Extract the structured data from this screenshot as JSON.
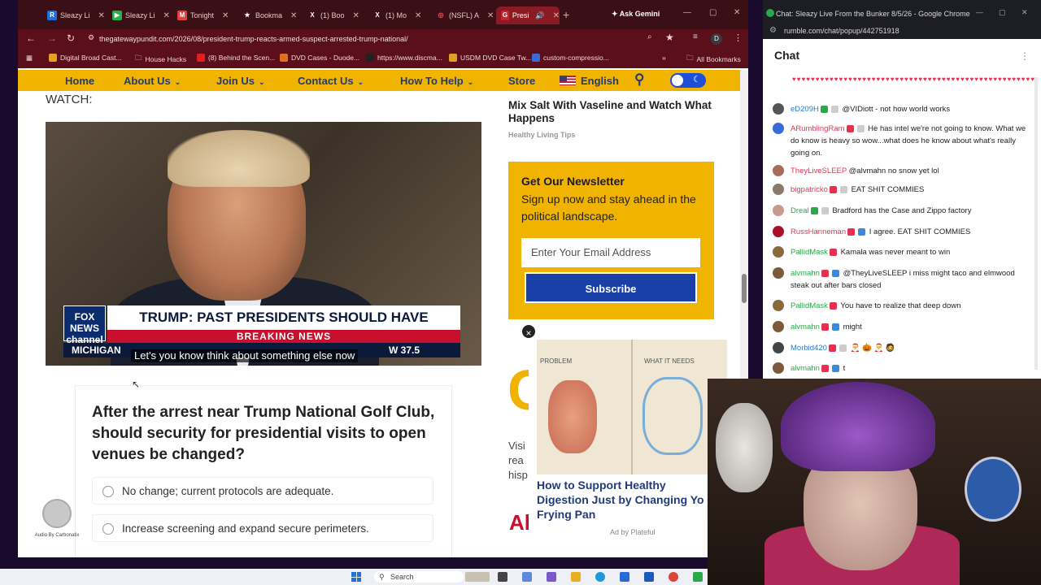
{
  "browser": {
    "tabs": [
      {
        "label": "Sleazy Li",
        "fav": "R",
        "color": "#1e6fe0"
      },
      {
        "label": "Sleazy Li",
        "fav": "▶",
        "color": "#24b14a"
      },
      {
        "label": "Tonight",
        "fav": "M",
        "color": "#e04040"
      },
      {
        "label": "Bookma",
        "fav": "★",
        "color": "#7a2a30"
      },
      {
        "label": "(1) Boo",
        "fav": "X",
        "color": "#222222"
      },
      {
        "label": "(1) Mo",
        "fav": "X",
        "color": "#222222"
      },
      {
        "label": "(NSFL) A",
        "fav": "◎",
        "color": "#d83030"
      },
      {
        "label": "Presi",
        "fav": "G",
        "color": "#c82030"
      }
    ],
    "ask_gemini": "Ask Gemini",
    "url": "thegatewaypundit.com/2026/08/president-trump-reacts-armed-suspect-arrested-trump-national/",
    "profile_initial": "D",
    "bookmarks": [
      "Digital Broad Cast...",
      "House Hacks",
      "(8) Behind the Scen...",
      "DVD Cases - Duode...",
      "https://www.discma...",
      "USDM DVD Case Tw...",
      "custom-compressio..."
    ],
    "all_bookmarks": "All Bookmarks"
  },
  "nav": {
    "items": [
      "Home",
      "About Us",
      "Join Us",
      "Contact Us",
      "How To Help",
      "Store"
    ],
    "language": "English"
  },
  "article": {
    "watch_label": "WATCH:",
    "video": {
      "network": "FOX NEWS channel",
      "headline": "TRUMP: PAST PRESIDENTS SHOULD HAVE CONFRONTED IRAN",
      "breaking": "BREAKING NEWS",
      "ticker": "MICHIGAN",
      "ticker_right": "W 37.5",
      "caption": "Let's you know think about something else now"
    },
    "poll": {
      "question": "After the arrest near Trump National Golf Club, should security for presidential visits to open venues be changed?",
      "options": [
        "No change; current protocols are adequate.",
        "Increase screening and expand secure perimeters."
      ]
    },
    "audio_label": "Audio By Carbonatix"
  },
  "sidebar": {
    "article_title": "Mix Salt With Vaseline and Watch What Happens",
    "article_source": "Healthy Living Tips",
    "newsletter": {
      "title": "Get Our Newsletter",
      "subtitle": "Sign up now and stay ahead in the political landscape.",
      "input_placeholder": "Enter Your Email Address",
      "button": "Subscribe"
    },
    "partial_text": "Visi\nrea\nhisp",
    "big_letter": "C",
    "red_letters": "Al"
  },
  "ad": {
    "close": "×",
    "title": "How to Support Healthy Digestion Just by Changing Yo Frying Pan",
    "by": "Ad by Plateful",
    "img_labels": [
      "PROBLEM",
      "WHAT IT NEEDS"
    ]
  },
  "taskbar": {
    "search": "Search"
  },
  "chat": {
    "window_title": "Chat: Sleazy Live From the Bunker 8/5/26 - Google Chrome",
    "url": "rumble.com/chat/popup/442751918",
    "header": "Chat",
    "hearts": "♥♥♥♥♥♥♥♥♥♥♥♥♥♥♥♥♥♥♥♥♥♥♥♥♥♥♥♥♥♥♥♥♥♥♥♥♥♥♥♥♥♥♥♥♥♥♥♥♥♥♥♥",
    "messages": [
      {
        "user": "eD209H",
        "color": "#2a7ad8",
        "text": "@VIDiott - not how world works"
      },
      {
        "user": "ARumblingRam",
        "color": "#d83a5a",
        "text": "He has intel we're not going to know. What we do know is heavy so wow...what does he know about what's really going on."
      },
      {
        "user": "TheyLiveSLEEP",
        "color": "#d83a5a",
        "text": "@alvmahn no snow yet lol"
      },
      {
        "user": "bigpatricko",
        "color": "#d83a5a",
        "text": "EAT SHIT COMMIES"
      },
      {
        "user": "Dreal",
        "color": "#2aa84a",
        "text": "Bradford has the Case and Zippo factory"
      },
      {
        "user": "RussHanneman",
        "color": "#d83a5a",
        "text": "I agree. EAT SHIT COMMIES"
      },
      {
        "user": "PallidMask",
        "color": "#2aa84a",
        "text": "Kamala was never meant to win"
      },
      {
        "user": "alvmahn",
        "color": "#2aa84a",
        "text": "@TheyLiveSLEEP i miss might taco and elmwood steak out after bars closed"
      },
      {
        "user": "PallidMask",
        "color": "#2aa84a",
        "text": "You have to realize that deep down"
      },
      {
        "user": "alvmahn",
        "color": "#2aa84a",
        "text": "might"
      },
      {
        "user": "Morbid420",
        "color": "#2a7ad8",
        "text": "🎅 🎃 🎅 🧔"
      },
      {
        "user": "alvmahn",
        "color": "#2aa84a",
        "text": "t"
      }
    ]
  }
}
